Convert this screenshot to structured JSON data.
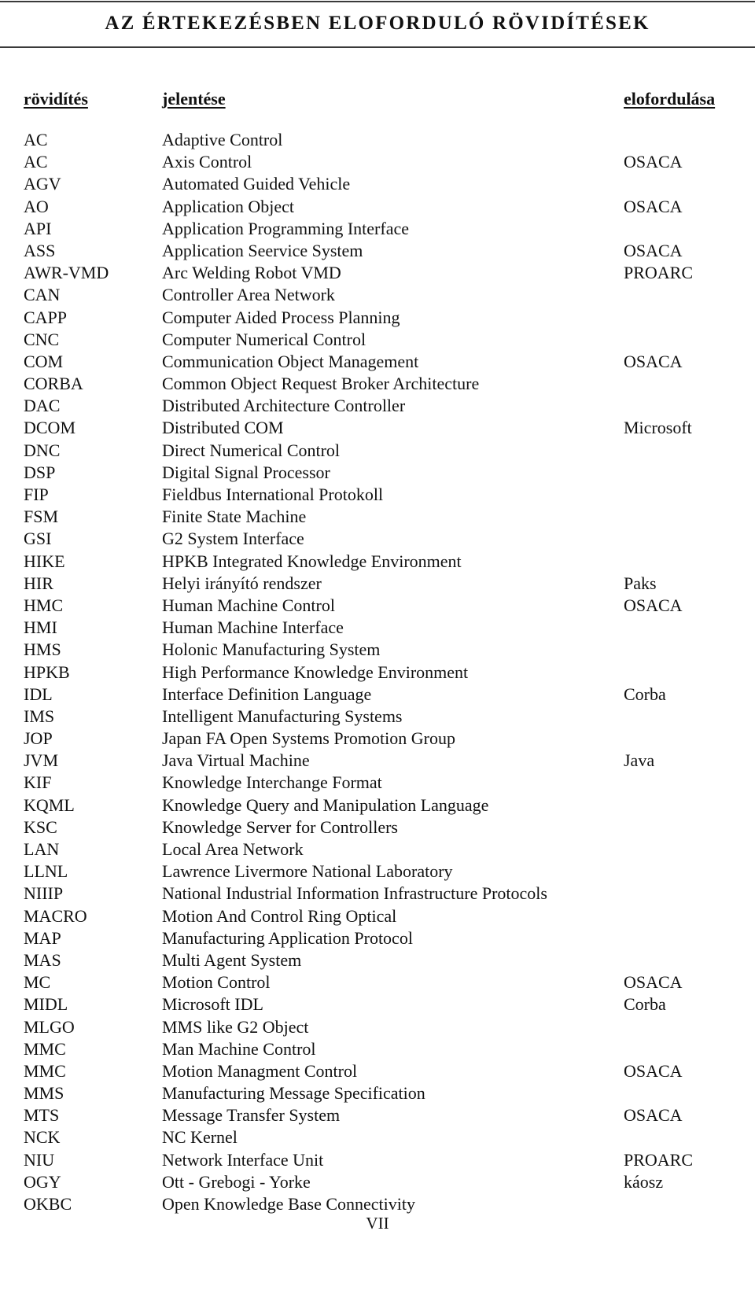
{
  "page": {
    "title": "AZ ÉRTEKEZÉSBEN ELOFORDULÓ RÖVIDÍTÉSEK",
    "page_number": "VII"
  },
  "table": {
    "headers": {
      "abbreviation": "rövidítés",
      "meaning": "jelentése",
      "occurrence": "elofordulása"
    },
    "rows": [
      {
        "abbr": "AC",
        "meaning": "Adaptive Control",
        "source": ""
      },
      {
        "abbr": "AC",
        "meaning": "Axis Control",
        "source": "OSACA"
      },
      {
        "abbr": "AGV",
        "meaning": "Automated Guided Vehicle",
        "source": ""
      },
      {
        "abbr": "AO",
        "meaning": "Application Object",
        "source": "OSACA"
      },
      {
        "abbr": "API",
        "meaning": "Application Programming Interface",
        "source": ""
      },
      {
        "abbr": "ASS",
        "meaning": "Application Seervice System",
        "source": "OSACA"
      },
      {
        "abbr": "AWR-VMD",
        "meaning": "Arc Welding Robot VMD",
        "source": "PROARC"
      },
      {
        "abbr": "CAN",
        "meaning": "Controller Area Network",
        "source": ""
      },
      {
        "abbr": "CAPP",
        "meaning": "Computer Aided Process Planning",
        "source": ""
      },
      {
        "abbr": "CNC",
        "meaning": "Computer Numerical Control",
        "source": ""
      },
      {
        "abbr": "COM",
        "meaning": "Communication Object Management",
        "source": "OSACA"
      },
      {
        "abbr": "CORBA",
        "meaning": "Common Object Request Broker Architecture",
        "source": ""
      },
      {
        "abbr": "DAC",
        "meaning": "Distributed Architecture Controller",
        "source": ""
      },
      {
        "abbr": "DCOM",
        "meaning": "Distributed COM",
        "source": "Microsoft"
      },
      {
        "abbr": "DNC",
        "meaning": "Direct Numerical Control",
        "source": ""
      },
      {
        "abbr": "DSP",
        "meaning": "Digital Signal Processor",
        "source": ""
      },
      {
        "abbr": "FIP",
        "meaning": "Fieldbus International Protokoll",
        "source": ""
      },
      {
        "abbr": "FSM",
        "meaning": "Finite State Machine",
        "source": ""
      },
      {
        "abbr": "GSI",
        "meaning": "G2 System Interface",
        "source": ""
      },
      {
        "abbr": "HIKE",
        "meaning": "HPKB Integrated Knowledge Environment",
        "source": ""
      },
      {
        "abbr": "HIR",
        "meaning": "Helyi irányító rendszer",
        "source": "Paks"
      },
      {
        "abbr": "HMC",
        "meaning": "Human Machine Control",
        "source": "OSACA"
      },
      {
        "abbr": "HMI",
        "meaning": "Human Machine Interface",
        "source": ""
      },
      {
        "abbr": "HMS",
        "meaning": "Holonic Manufacturing System",
        "source": ""
      },
      {
        "abbr": "HPKB",
        "meaning": "High Performance Knowledge Environment",
        "source": ""
      },
      {
        "abbr": "IDL",
        "meaning": "Interface Definition Language",
        "source": "Corba"
      },
      {
        "abbr": "IMS",
        "meaning": "Intelligent Manufacturing Systems",
        "source": ""
      },
      {
        "abbr": "JOP",
        "meaning": "Japan FA Open Systems Promotion Group",
        "source": ""
      },
      {
        "abbr": "JVM",
        "meaning": "Java Virtual Machine",
        "source": "Java"
      },
      {
        "abbr": "KIF",
        "meaning": "Knowledge Interchange Format",
        "source": ""
      },
      {
        "abbr": "KQML",
        "meaning": "Knowledge Query and Manipulation Language",
        "source": ""
      },
      {
        "abbr": "KSC",
        "meaning": "Knowledge Server for Controllers",
        "source": ""
      },
      {
        "abbr": "LAN",
        "meaning": "Local Area Network",
        "source": ""
      },
      {
        "abbr": "LLNL",
        "meaning": "Lawrence Livermore National Laboratory",
        "source": ""
      },
      {
        "abbr": "NIIIP",
        "meaning": "National Industrial Information Infrastructure Protocols",
        "source": ""
      },
      {
        "abbr": "MACRO",
        "meaning": "Motion And Control Ring Optical",
        "source": ""
      },
      {
        "abbr": "MAP",
        "meaning": "Manufacturing Application Protocol",
        "source": ""
      },
      {
        "abbr": "MAS",
        "meaning": "Multi Agent System",
        "source": ""
      },
      {
        "abbr": "MC",
        "meaning": "Motion Control",
        "source": "OSACA"
      },
      {
        "abbr": "MIDL",
        "meaning": "Microsoft IDL",
        "source": "Corba"
      },
      {
        "abbr": "MLGO",
        "meaning": "MMS like G2 Object",
        "source": ""
      },
      {
        "abbr": "MMC",
        "meaning": "Man Machine Control",
        "source": ""
      },
      {
        "abbr": "MMC",
        "meaning": "Motion Managment Control",
        "source": "OSACA"
      },
      {
        "abbr": "MMS",
        "meaning": "Manufacturing Message Specification",
        "source": ""
      },
      {
        "abbr": "MTS",
        "meaning": "Message Transfer System",
        "source": "OSACA"
      },
      {
        "abbr": "NCK",
        "meaning": "NC Kernel",
        "source": ""
      },
      {
        "abbr": "NIU",
        "meaning": "Network Interface Unit",
        "source": "PROARC"
      },
      {
        "abbr": "OGY",
        "meaning": "Ott - Grebogi - Yorke",
        "source": "káosz"
      },
      {
        "abbr": "OKBC",
        "meaning": "Open Knowledge Base Connectivity",
        "source": ""
      }
    ]
  }
}
